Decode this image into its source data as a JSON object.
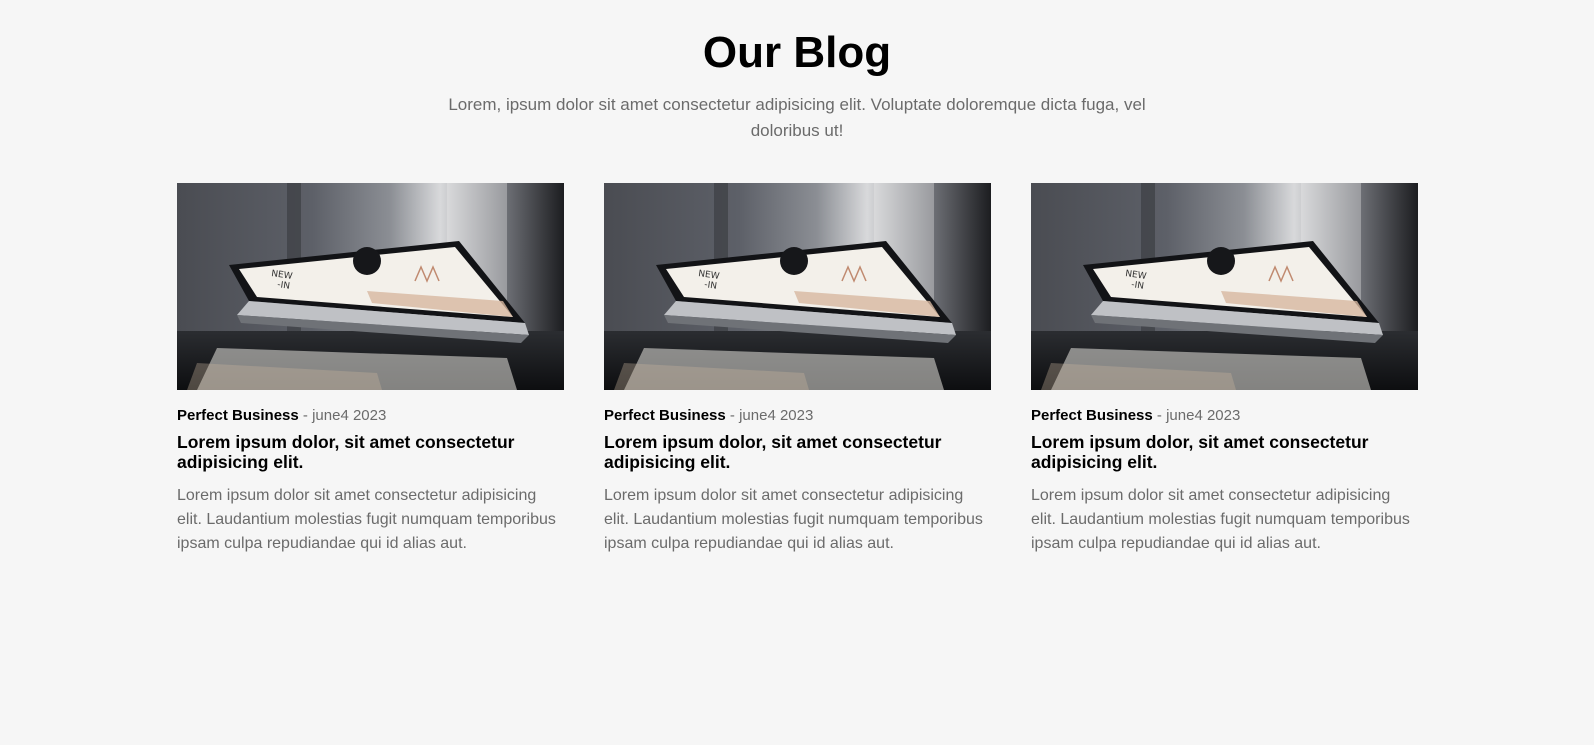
{
  "section": {
    "title": "Our Blog",
    "subtitle": "Lorem, ipsum dolor sit amet consectetur adipisicing elit. Voluptate doloremque dicta fuga, vel doloribus ut!"
  },
  "posts": [
    {
      "image": "laptop-photo",
      "category": "Perfect Business",
      "separator": " - ",
      "date": "june4 2023",
      "title": "Lorem ipsum dolor, sit amet consectetur adipisicing elit.",
      "excerpt": "Lorem ipsum dolor sit amet consectetur adipisicing elit. Laudantium molestias fugit numquam temporibus ipsam culpa repudiandae qui id alias aut."
    },
    {
      "image": "laptop-photo",
      "category": "Perfect Business",
      "separator": " - ",
      "date": "june4 2023",
      "title": "Lorem ipsum dolor, sit amet consectetur adipisicing elit.",
      "excerpt": "Lorem ipsum dolor sit amet consectetur adipisicing elit. Laudantium molestias fugit numquam temporibus ipsam culpa repudiandae qui id alias aut."
    },
    {
      "image": "laptop-photo",
      "category": "Perfect Business",
      "separator": " - ",
      "date": "june4 2023",
      "title": "Lorem ipsum dolor, sit amet consectetur adipisicing elit.",
      "excerpt": "Lorem ipsum dolor sit amet consectetur adipisicing elit. Laudantium molestias fugit numquam temporibus ipsam culpa repudiandae qui id alias aut."
    }
  ],
  "colors": {
    "background": "#f6f6f6",
    "heading": "#000000",
    "muted_text": "#6b6b6b"
  }
}
